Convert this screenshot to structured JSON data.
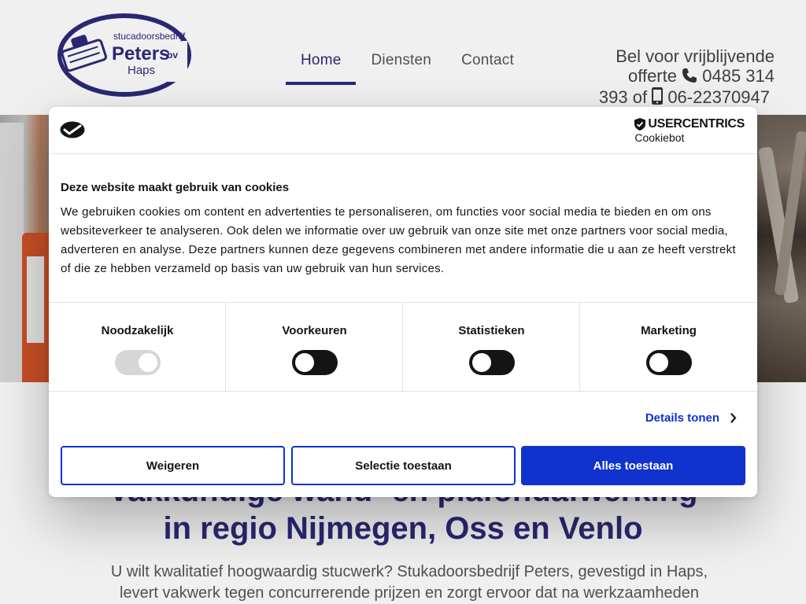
{
  "logo": {
    "line1": "stucadoorsbedrijf",
    "name": "Peters",
    "suffix": "bv",
    "place": "Haps"
  },
  "nav": {
    "items": [
      {
        "label": "Home",
        "active": true
      },
      {
        "label": "Diensten",
        "active": false
      },
      {
        "label": "Contact",
        "active": false
      }
    ]
  },
  "contact": {
    "line1": "Bel voor vrijblijvende",
    "line2_prefix": "offerte",
    "phone": "0485 314",
    "phone_cont": "393",
    "or": "of",
    "mobile": "06-22370947"
  },
  "main": {
    "heading_line1": "Vakkundige wand- en plafondafwerking",
    "heading_line2": "in regio Nijmegen, Oss en Venlo",
    "intro": "U wilt kwalitatief hoogwaardig stucwerk? Stukadoorsbedrijf Peters, gevestigd in Haps, levert vakwerk tegen concurrerende prijzen en zorgt ervoor dat na werkzaamheden"
  },
  "cookie": {
    "brand": "USERCENTRICS",
    "brand_sub": "Cookiebot",
    "title": "Deze website maakt gebruik van cookies",
    "text": "We gebruiken cookies om content en advertenties te personaliseren, om functies voor social media te bieden en om ons websiteverkeer te analyseren. Ook delen we informatie over uw gebruik van onze site met onze partners voor social media, adverteren en analyse. Deze partners kunnen deze gegevens combineren met andere informatie die u aan ze heeft verstrekt of die ze hebben verzameld op basis van uw gebruik van hun services.",
    "categories": [
      {
        "label": "Noodzakelijk",
        "enabled": true,
        "locked": true
      },
      {
        "label": "Voorkeuren",
        "enabled": false,
        "locked": false
      },
      {
        "label": "Statistieken",
        "enabled": false,
        "locked": false
      },
      {
        "label": "Marketing",
        "enabled": false,
        "locked": false
      }
    ],
    "details_label": "Details tonen",
    "buttons": {
      "deny": "Weigeren",
      "selection": "Selectie toestaan",
      "allow_all": "Alles toestaan"
    }
  },
  "colors": {
    "brand_navy": "#2d2a7a",
    "cookie_blue": "#1032cf",
    "text_dark": "#141414"
  }
}
